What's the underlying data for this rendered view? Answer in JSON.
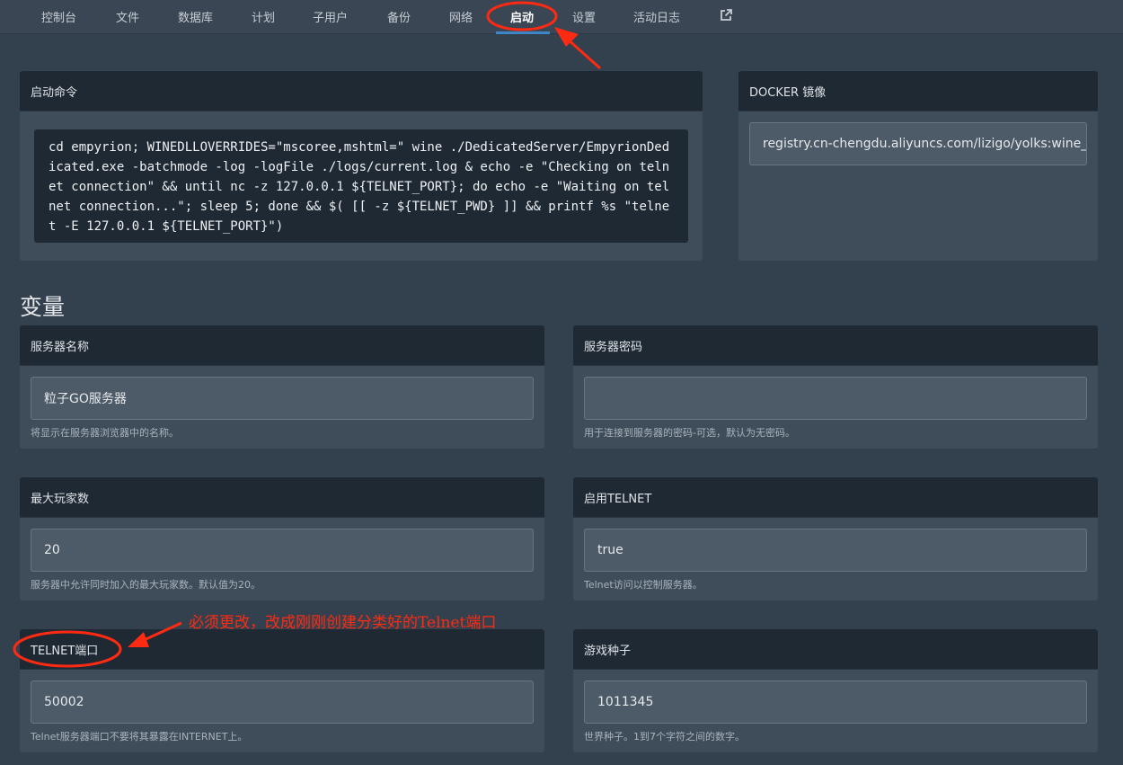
{
  "nav": {
    "items": [
      "控制台",
      "文件",
      "数据库",
      "计划",
      "子用户",
      "备份",
      "网络",
      "启动",
      "设置",
      "活动日志"
    ],
    "active": "启动",
    "external_icon": "external-link-icon"
  },
  "startup": {
    "title": "启动命令",
    "command": "cd empyrion; WINEDLLOVERRIDES=\"mscoree,mshtml=\" wine ./DedicatedServer/EmpyrionDedicated.exe -batchmode -log -logFile ./logs/current.log & echo -e \"Checking on telnet connection\" && until nc -z 127.0.0.1 ${TELNET_PORT}; do echo -e \"Waiting on telnet connection...\"; sleep 5; done && $( [[ -z ${TELNET_PWD} ]] && printf %s \"telnet -E 127.0.0.1 ${TELNET_PORT}\")"
  },
  "docker": {
    "title": "DOCKER 镜像",
    "value": "registry.cn-chengdu.aliyuncs.com/lizigo/yolks:wine_s"
  },
  "variables": {
    "title": "变量",
    "items": [
      {
        "label": "服务器名称",
        "value": "粒子GO服务器",
        "help": "将显示在服务器浏览器中的名称。"
      },
      {
        "label": "服务器密码",
        "value": "",
        "help": "用于连接到服务器的密码-可选，默认为无密码。"
      },
      {
        "label": "最大玩家数",
        "value": "20",
        "help": "服务器中允许同时加入的最大玩家数。默认值为20。"
      },
      {
        "label": "启用TELNET",
        "value": "true",
        "help": "Telnet访问以控制服务器。"
      },
      {
        "label": "TELNET端口",
        "value": "50002",
        "help": "Telnet服务器端口不要将其暴露在INTERNET上。"
      },
      {
        "label": "游戏种子",
        "value": "1011345",
        "help": "世界种子。1到7个字符之间的数字。"
      }
    ]
  },
  "annotation": {
    "text": "必须更改，改成刚刚创建分类好的Telnet端口",
    "color": "#ff2a12"
  }
}
